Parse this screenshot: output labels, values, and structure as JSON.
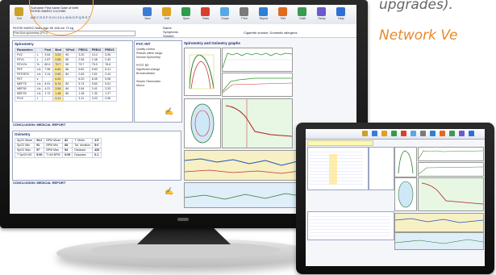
{
  "promo": {
    "line1": "upgrades).",
    "line2": "Network Ve"
  },
  "colors": {
    "accent_orange": "#e8882a",
    "brand_blue": "#1b2d6b",
    "highlight": "#ffe89a"
  },
  "toolbar": {
    "buttons": [
      {
        "label": "Exit",
        "icon": "exit-icon",
        "color": "#c9a227"
      },
      {
        "label": "New",
        "icon": "new-icon",
        "color": "#3c7bd4"
      },
      {
        "label": "Edit",
        "icon": "edit-icon",
        "color": "#e0a020"
      },
      {
        "label": "Spiro",
        "icon": "spiro-icon",
        "color": "#2e9c4a"
      },
      {
        "label": "Tests",
        "icon": "tests-icon",
        "color": "#d6402f"
      },
      {
        "label": "Graph",
        "icon": "graph-icon",
        "color": "#5aa7e8"
      },
      {
        "label": "Print",
        "icon": "print-icon",
        "color": "#7b7b7b"
      },
      {
        "label": "Report",
        "icon": "report-icon",
        "color": "#2f7fd4"
      },
      {
        "label": "Ref",
        "icon": "reference-icon",
        "color": "#e06c20"
      },
      {
        "label": "Calib",
        "icon": "calibration-icon",
        "color": "#3a9a52"
      },
      {
        "label": "Setup",
        "icon": "setup-icon",
        "color": "#6a5acd"
      },
      {
        "label": "Help",
        "icon": "help-icon",
        "color": "#2f6fd4"
      }
    ]
  },
  "patient": {
    "line1": "Surname  First name  Date of birth",
    "line2": "ROSSI MARIO  1/1/1950",
    "ids": "A B C D E F G H I J K L M N O P Q R S T"
  },
  "subhead": {
    "left": "ROSSI MARIO  Male  Age 65  168 cm  70 kg",
    "combo": "Free-flow spirometry (FVC)",
    "right1": "Name",
    "right2": "Symptoms",
    "right3": "Smoker",
    "summary": "Cigarette smoker, Domestic allergens"
  },
  "spirometry": {
    "title": "Spirometry",
    "headers": [
      "Parameters",
      "",
      "Pred",
      "Best",
      "%Pred",
      "PRE#1",
      "PRE#2",
      "PRE#3"
    ],
    "rows": [
      [
        "FVC",
        "L",
        "3.54",
        "3.20",
        "90",
        "3.20",
        "3.14",
        "3.05"
      ],
      [
        "FEV1",
        "L",
        "2.87",
        "2.55",
        "89",
        "2.55",
        "2.48",
        "2.40"
      ],
      [
        "FEV1%",
        "%",
        "80.0",
        "79.7",
        "99",
        "79.7",
        "79.0",
        "78.6"
      ],
      [
        "PEF",
        "L/s",
        "7.96",
        "6.82",
        "86",
        "6.82",
        "6.60",
        "6.41"
      ],
      [
        "FEF2575",
        "L/s",
        "3.14",
        "2.63",
        "84",
        "2.63",
        "2.51",
        "2.44"
      ],
      [
        "FET",
        "s",
        "",
        "6.20",
        "",
        "6.20",
        "6.05",
        "5.98"
      ],
      [
        "MEF75",
        "L/s",
        "6.91",
        "5.74",
        "83",
        "5.74",
        "5.60",
        "5.51"
      ],
      [
        "MEF50",
        "L/s",
        "4.21",
        "3.54",
        "84",
        "3.54",
        "3.41",
        "3.33"
      ],
      [
        "MEF25",
        "L/s",
        "1.72",
        "1.38",
        "80",
        "1.38",
        "1.30",
        "1.27"
      ],
      [
        "FIVC",
        "L",
        "",
        "3.11",
        "",
        "3.11",
        "3.02",
        "2.96"
      ]
    ],
    "conclusion": "CONCLUSION: MEDICAL REPORT"
  },
  "interpretation": {
    "title": "FVC INT",
    "lines": [
      "Quality control",
      "Results within range",
      "Normal Spirometry",
      "",
      "POST BD",
      "Significant change",
      "Bronchodilator",
      "",
      "Simple Obstruction",
      "Mixed"
    ]
  },
  "graphs": {
    "title": "Spirometry and Oximetry graphs"
  },
  "oximetry": {
    "title": "Oximetry",
    "rows": [
      [
        "SpO2 Mean",
        "94.2",
        "BPM Mean",
        "82",
        "T. Meter",
        "4:5"
      ],
      [
        "SpO2 Min",
        "91",
        "BPM Min",
        "68",
        "Tot. duration",
        "5:0"
      ],
      [
        "SpO2 Max",
        "97",
        "BPM Max",
        "94",
        "Distance",
        "420"
      ],
      [
        "T SpO2<90",
        "0:00",
        "T<40 BPM",
        "0:00",
        "Dyspnea",
        "0-1"
      ]
    ],
    "conclusion": "CONCLUSION: MEDICAL REPORT"
  }
}
